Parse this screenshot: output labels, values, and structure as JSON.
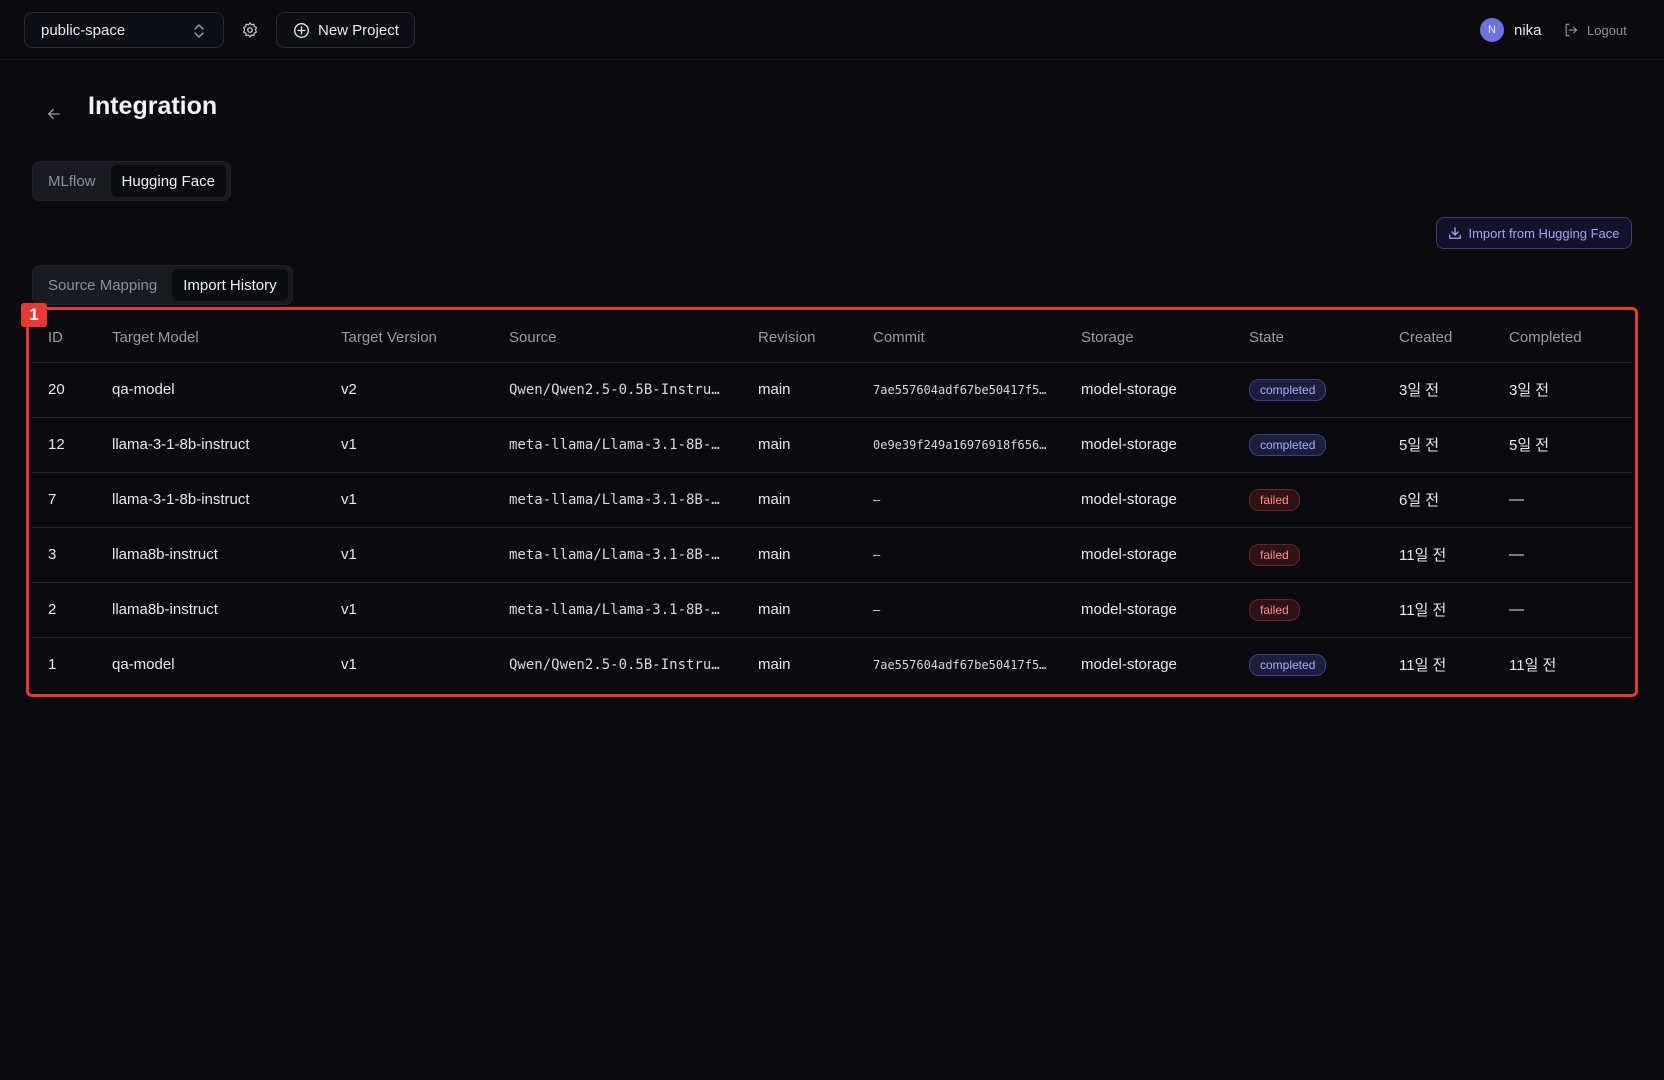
{
  "topbar": {
    "workspace": "public-space",
    "new_project_label": "New Project",
    "user_initial": "N",
    "user_name": "nika",
    "logout_label": "Logout"
  },
  "page": {
    "title": "Integration"
  },
  "integration_tabs": [
    {
      "label": "MLflow",
      "active": false
    },
    {
      "label": "Hugging Face",
      "active": true
    }
  ],
  "sub_tabs": [
    {
      "label": "Source Mapping",
      "active": false
    },
    {
      "label": "Import History",
      "active": true
    }
  ],
  "import_button_label": "Import from Hugging Face",
  "annotation_marker": "1",
  "table": {
    "headers": [
      "ID",
      "Target Model",
      "Target Version",
      "Source",
      "Revision",
      "Commit",
      "Storage",
      "State",
      "Created",
      "Completed"
    ],
    "rows": [
      {
        "id": "20",
        "target_model": "qa-model",
        "target_version": "v2",
        "source": "Qwen/Qwen2.5-0.5B-Instru…",
        "revision": "main",
        "commit": "7ae557604adf67be50417f5…",
        "storage": "model-storage",
        "state": "completed",
        "created": "3일 전",
        "completed": "3일 전"
      },
      {
        "id": "12",
        "target_model": "llama-3-1-8b-instruct",
        "target_version": "v1",
        "source": "meta-llama/Llama-3.1-8B-…",
        "revision": "main",
        "commit": "0e9e39f249a16976918f656…",
        "storage": "model-storage",
        "state": "completed",
        "created": "5일 전",
        "completed": "5일 전"
      },
      {
        "id": "7",
        "target_model": "llama-3-1-8b-instruct",
        "target_version": "v1",
        "source": "meta-llama/Llama-3.1-8B-…",
        "revision": "main",
        "commit": "–",
        "storage": "model-storage",
        "state": "failed",
        "created": "6일 전",
        "completed": "—"
      },
      {
        "id": "3",
        "target_model": "llama8b-instruct",
        "target_version": "v1",
        "source": "meta-llama/Llama-3.1-8B-…",
        "revision": "main",
        "commit": "–",
        "storage": "model-storage",
        "state": "failed",
        "created": "11일 전",
        "completed": "—"
      },
      {
        "id": "2",
        "target_model": "llama8b-instruct",
        "target_version": "v1",
        "source": "meta-llama/Llama-3.1-8B-…",
        "revision": "main",
        "commit": "–",
        "storage": "model-storage",
        "state": "failed",
        "created": "11일 전",
        "completed": "—"
      },
      {
        "id": "1",
        "target_model": "qa-model",
        "target_version": "v1",
        "source": "Qwen/Qwen2.5-0.5B-Instru…",
        "revision": "main",
        "commit": "7ae557604adf67be50417f5…",
        "storage": "model-storage",
        "state": "completed",
        "created": "11일 전",
        "completed": "11일 전"
      }
    ]
  },
  "icons": {
    "workspace_chevron": "chevron-up-down-icon",
    "settings": "gear-icon",
    "new_project": "plus-circle-icon",
    "logout": "logout-icon",
    "back": "arrow-left-icon",
    "import": "download-icon"
  },
  "colors": {
    "background": "#0a0a0f",
    "accent": "#a7b0ff",
    "failed": "#ff8c8c",
    "annotation": "#e53935"
  }
}
